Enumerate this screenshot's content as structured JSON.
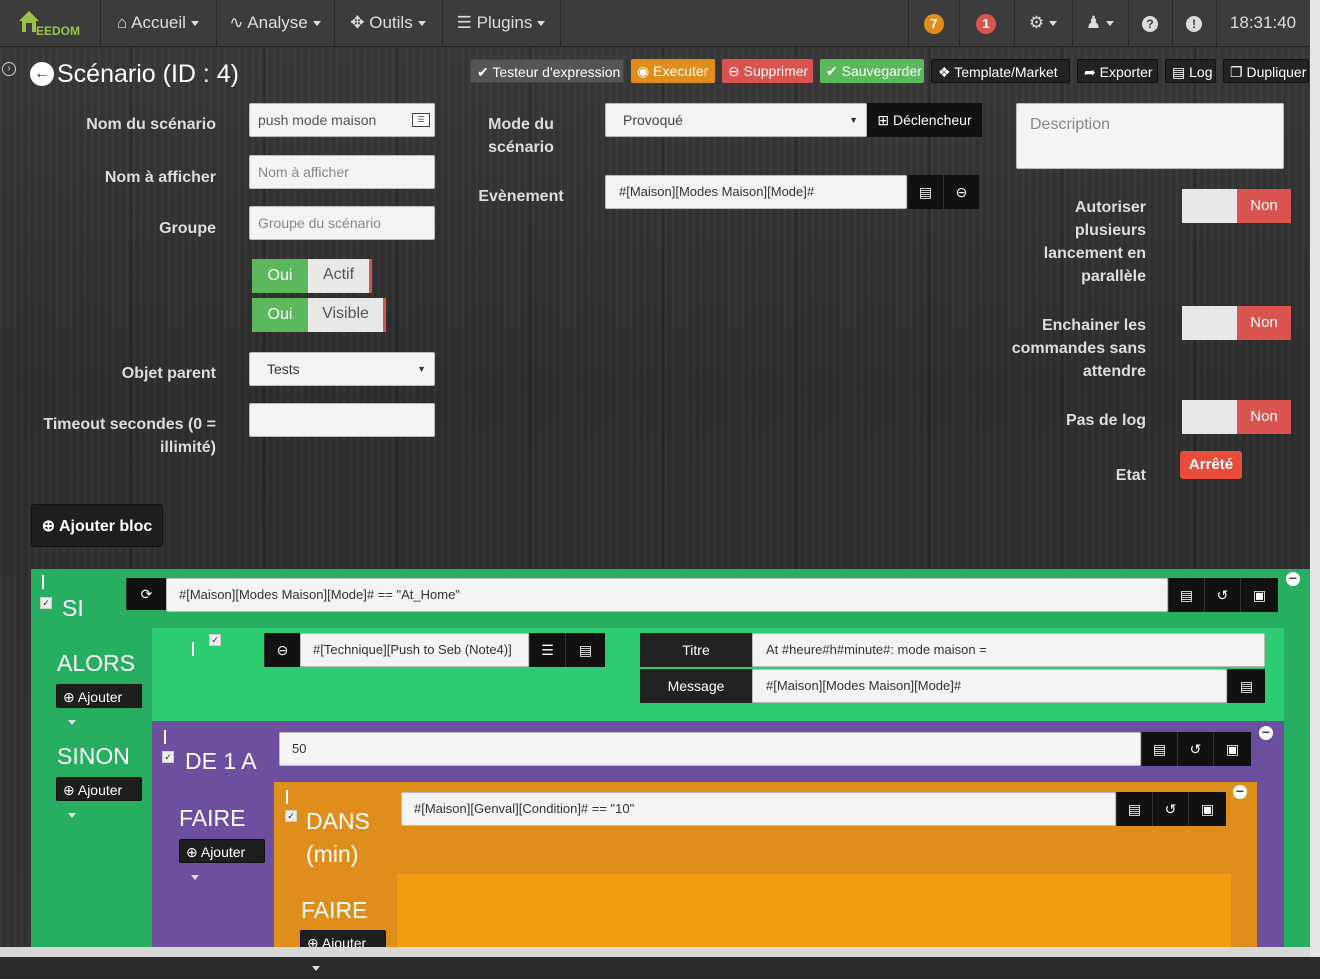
{
  "navbar": {
    "brand": "EEDOM",
    "menus": [
      {
        "label": "Accueil",
        "icon": "home-icon"
      },
      {
        "label": "Analyse",
        "icon": "pulse-icon"
      },
      {
        "label": "Outils",
        "icon": "wrench-icon"
      },
      {
        "label": "Plugins",
        "icon": "tasks-icon"
      }
    ],
    "badge_orange": "7",
    "badge_red": "1",
    "time": "18:31:40"
  },
  "page_title": "Scénario (ID : 4)",
  "toolbar": {
    "testeur": "Testeur d'expression",
    "executer": "Executer",
    "supprimer": "Supprimer",
    "sauvegarder": "Sauvegarder",
    "template": "Template/Market",
    "exporter": "Exporter",
    "log": "Log",
    "dupliquer": "Dupliquer"
  },
  "form": {
    "nom_label": "Nom du scénario",
    "nom_value": "push mode maison",
    "afficher_label": "Nom à afficher",
    "afficher_placeholder": "Nom à afficher",
    "groupe_label": "Groupe",
    "groupe_placeholder": "Groupe du scénario",
    "actif_on": "Oui",
    "actif_label": "Actif",
    "visible_on": "Oui",
    "visible_label": "Visible",
    "objet_label": "Objet parent",
    "objet_value": "Tests",
    "timeout_label_1": "Timeout secondes (0 =",
    "timeout_label_2": "illimité)",
    "timeout_value": "",
    "mode_label_1": "Mode du",
    "mode_label_2": "scénario",
    "mode_value": "Provoqué",
    "declencheur": "Déclencheur",
    "evenement_label": "Evènement",
    "evenement_value": "#[Maison][Modes Maison][Mode]#",
    "description_placeholder": "Description",
    "autoriser_1": "Autoriser",
    "autoriser_2": "plusieurs",
    "autoriser_3": "lancement en",
    "autoriser_4": "parallèle",
    "autoriser_value": "Non",
    "enchainer_1": "Enchainer les",
    "enchainer_2": "commandes sans",
    "enchainer_3": "attendre",
    "enchainer_value": "Non",
    "pasdelog_label": "Pas de log",
    "pasdelog_value": "Non",
    "etat_label": "Etat",
    "etat_value": "Arrêté"
  },
  "ajouter_bloc": "Ajouter bloc",
  "blocks": {
    "si_label": "SI",
    "si_condition": "#[Maison][Modes Maison][Mode]# == \"At_Home\"",
    "alors_label": "ALORS",
    "alors_ajouter": "Ajouter",
    "action_cmd": "#[Technique][Push to Seb (Note4)]",
    "titre_label": "Titre",
    "titre_value": "At #heure#h#minute#: mode maison =",
    "message_label": "Message",
    "message_value": "#[Maison][Modes Maison][Mode]#",
    "sinon_label": "SINON",
    "sinon_ajouter": "Ajouter",
    "de_label": "DE 1 A",
    "de_value": "50",
    "faire_label": "FAIRE",
    "faire_ajouter": "Ajouter",
    "dans_label_1": "DANS",
    "dans_label_2": "(min)",
    "dans_value": "#[Maison][Genval][Condition]# == \"10\"",
    "faire2_label": "FAIRE",
    "faire2_ajouter": "Ajouter"
  },
  "colors": {
    "green": "#27ae60",
    "green_inner": "#2ecc71",
    "purple": "#6c4f9e",
    "orange": "#e08e1b",
    "orange_inner": "#f39c12",
    "red": "#d9534f"
  }
}
